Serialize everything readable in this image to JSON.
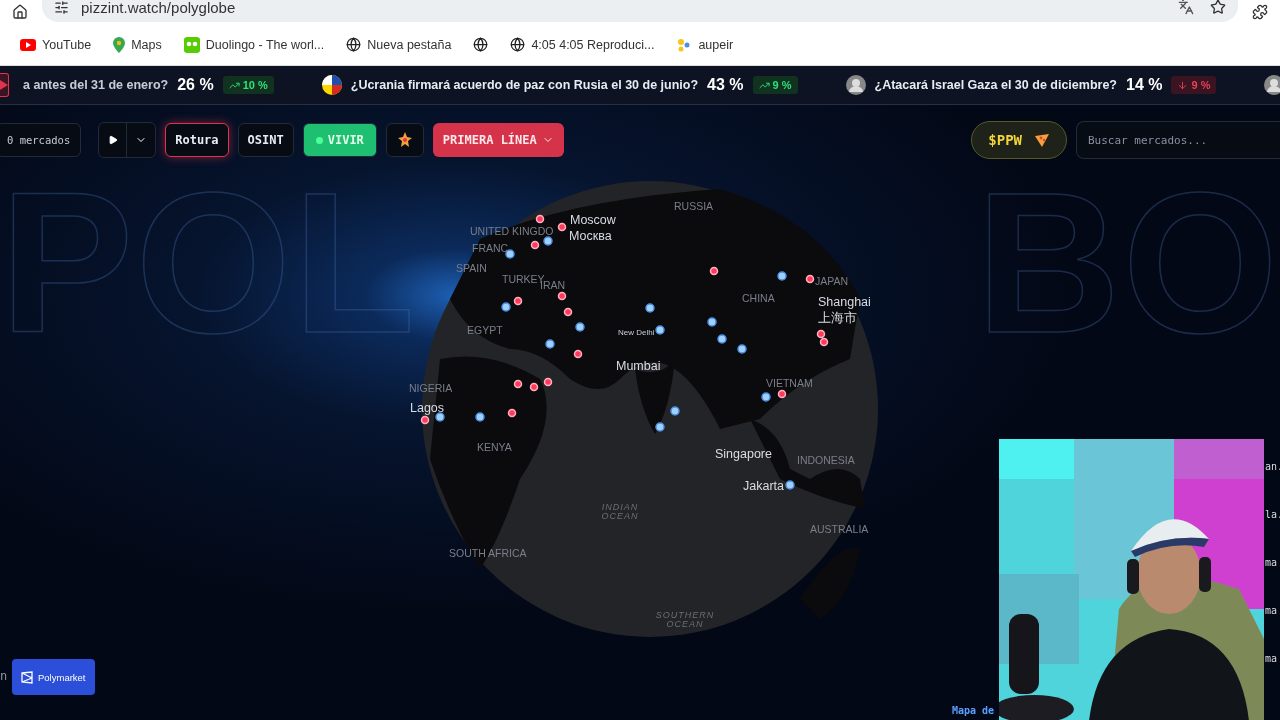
{
  "browser": {
    "address": "pizzint.watch/polyglobe"
  },
  "bookmarks": [
    {
      "kind": "youtube",
      "label": "YouTube"
    },
    {
      "kind": "maps",
      "label": "Maps"
    },
    {
      "kind": "duolingo",
      "label": "Duolingo - The worl..."
    },
    {
      "kind": "globe",
      "label": "Nueva pestaña"
    },
    {
      "kind": "globe"
    },
    {
      "kind": "globe",
      "label": "4:05 4:05 Reproduci..."
    },
    {
      "kind": "aupeir",
      "label": "aupeir"
    }
  ],
  "ticker": [
    {
      "question": "a antes del 31 de enero?",
      "percent": "26 %",
      "change": {
        "kind": "up",
        "text": "10 %"
      }
    },
    {
      "avatar": {
        "kind": "flag"
      },
      "question": "¿Ucrania firmará acuerdo de paz con Rusia el 30 de junio?",
      "percent": "43 %",
      "change": {
        "kind": "up",
        "text": "9 %"
      }
    },
    {
      "avatar": {
        "kind": "person"
      },
      "question": "¿Atacará Israel Gaza el 30 de diciembre?",
      "percent": "14 %",
      "change": {
        "kind": "down",
        "text": "9 %"
      }
    },
    {
      "avatar": {
        "kind": "person"
      }
    }
  ],
  "toolbar": {
    "market_count": "0 mercados",
    "modes": [
      {
        "label": "Rotura",
        "selected": true
      },
      {
        "label": "OSINT",
        "selected": false
      }
    ],
    "live": {
      "label": "VIVIR",
      "on": true
    },
    "frontline": "PRIMERA LÍNEA",
    "token": "$PPW",
    "search": {
      "placeholder": "Buscar mercados..."
    }
  },
  "background_title": [
    "POL",
    "BO"
  ],
  "globe_labels": [
    {
      "kind": "country",
      "text": "UNITED KINGDO"
    },
    {
      "kind": "country",
      "text": "FRANC"
    },
    {
      "kind": "country",
      "text": "SPAIN"
    },
    {
      "kind": "country",
      "text": "TURKEY"
    },
    {
      "kind": "country",
      "text": "IRAN"
    },
    {
      "kind": "country",
      "text": "EGYPT"
    },
    {
      "kind": "city",
      "text": "Moscow"
    },
    {
      "kind": "city",
      "text": "Москва"
    },
    {
      "kind": "country",
      "text": "RUSSIA"
    },
    {
      "kind": "country",
      "text": "CHINA"
    },
    {
      "kind": "country",
      "text": "JAPAN"
    },
    {
      "kind": "city",
      "text": "Shanghai"
    },
    {
      "kind": "city",
      "text": "上海市"
    },
    {
      "kind": "capital",
      "text": "New Delhi"
    },
    {
      "kind": "city",
      "text": "Mumbai"
    },
    {
      "kind": "country",
      "text": "NIGERIA"
    },
    {
      "kind": "city",
      "text": "Lagos"
    },
    {
      "kind": "country",
      "text": "KENYA"
    },
    {
      "kind": "country",
      "text": "VIETNAM"
    },
    {
      "kind": "city",
      "text": "Singapore"
    },
    {
      "kind": "country",
      "text": "INDONESIA"
    },
    {
      "kind": "city",
      "text": "Jakarta"
    },
    {
      "kind": "ocean",
      "text": "INDIAN OCEAN"
    },
    {
      "kind": "country",
      "text": "AUSTRALIA"
    },
    {
      "kind": "country",
      "text": "SOUTH AFRICA"
    },
    {
      "kind": "ocean",
      "text": "SOUTHERN OCEAN"
    }
  ],
  "source_button": "Polymarket",
  "left_fragment": "n",
  "bottom_fragment": "Mapa de",
  "side_fragments": [
    "an.",
    "la.",
    "ma",
    "ma",
    "ma"
  ]
}
